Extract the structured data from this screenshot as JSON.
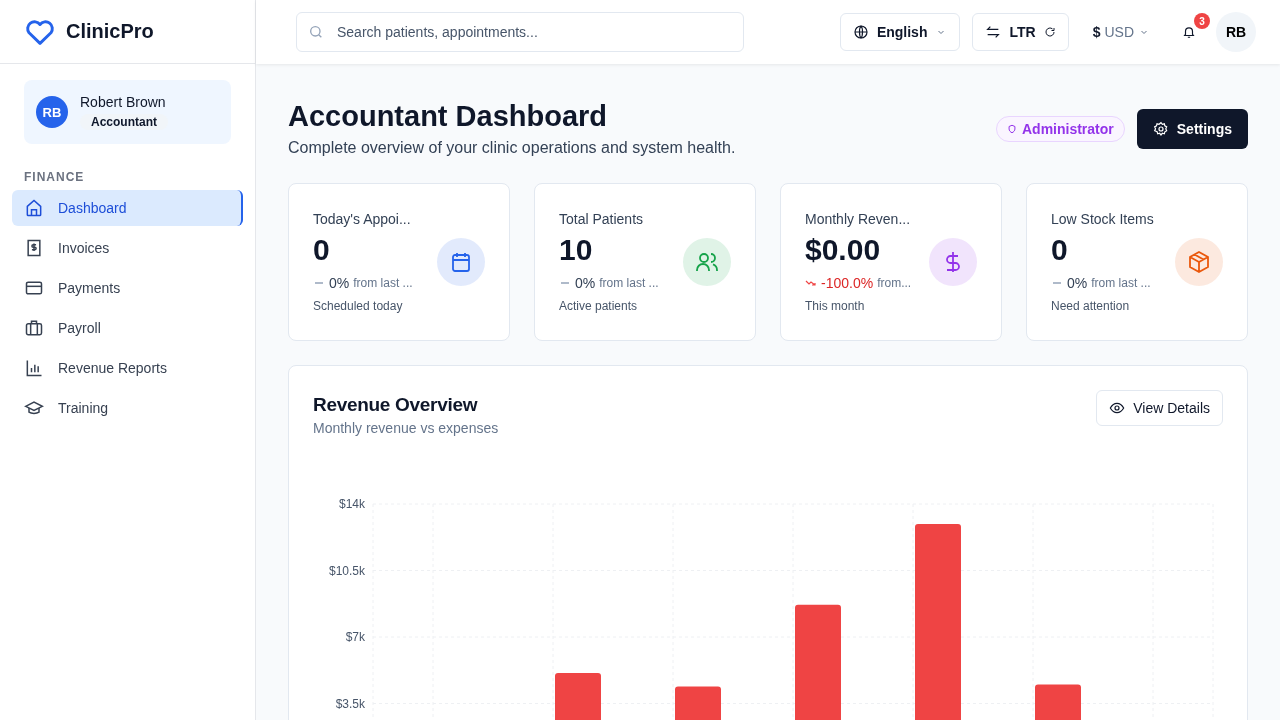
{
  "brand": {
    "name": "ClinicPro"
  },
  "user": {
    "initials": "RB",
    "name": "Robert Brown",
    "role": "Accountant"
  },
  "sidebar": {
    "section": "FINANCE",
    "items": [
      {
        "label": "Dashboard",
        "kind": "home",
        "selected": true
      },
      {
        "label": "Invoices",
        "kind": "invoice",
        "selected": false
      },
      {
        "label": "Payments",
        "kind": "card",
        "selected": false
      },
      {
        "label": "Payroll",
        "kind": "briefcase",
        "selected": false
      },
      {
        "label": "Revenue Reports",
        "kind": "chart",
        "selected": false
      },
      {
        "label": "Training",
        "kind": "cap",
        "selected": false
      }
    ]
  },
  "header": {
    "search": {
      "placeholder": "Search patients, appointments..."
    },
    "language": "English",
    "direction": "LTR",
    "currency_symbol": "$",
    "currency": "USD",
    "notifications": "3",
    "avatar": "RB"
  },
  "page": {
    "title": "Accountant Dashboard",
    "subtitle": "Complete overview of your clinic operations and system health.",
    "role_badge": "Administrator",
    "settings_button": "Settings"
  },
  "stats": [
    {
      "title": "Today's Appoi...",
      "value": "0",
      "kind": "flat",
      "change": "0%",
      "change_note": "from last ...",
      "note": "Scheduled today",
      "color": "#2563eb"
    },
    {
      "title": "Total Patients",
      "value": "10",
      "kind": "flat",
      "change": "0%",
      "change_note": "from last ...",
      "note": "Active patients",
      "color": "#16a34a"
    },
    {
      "title": "Monthly Reven...",
      "value": "$0.00",
      "kind": "down",
      "change": "-100.0%",
      "change_note": "from...",
      "note": "This month",
      "color": "#9333ea"
    },
    {
      "title": "Low Stock Items",
      "value": "0",
      "kind": "flat",
      "change": "0%",
      "change_note": "from last ...",
      "note": "Need attention",
      "color": "#ea580c"
    }
  ],
  "revenue": {
    "title": "Revenue Overview",
    "subtitle": "Monthly revenue vs expenses",
    "button": "View Details",
    "chart_data": {
      "type": "bar",
      "grid": true,
      "ylim": [
        0,
        14000
      ],
      "yticks": [
        {
          "value": 3500,
          "label": "$3.5k"
        },
        {
          "value": 7000,
          "label": "$7k"
        },
        {
          "value": 10500,
          "label": "$10.5k"
        },
        {
          "value": 14000,
          "label": "$14k"
        }
      ],
      "series": [
        {
          "color": "#ef4444",
          "values": [
            0,
            5100,
            4400,
            8700,
            12950,
            4500,
            0
          ]
        }
      ]
    }
  }
}
